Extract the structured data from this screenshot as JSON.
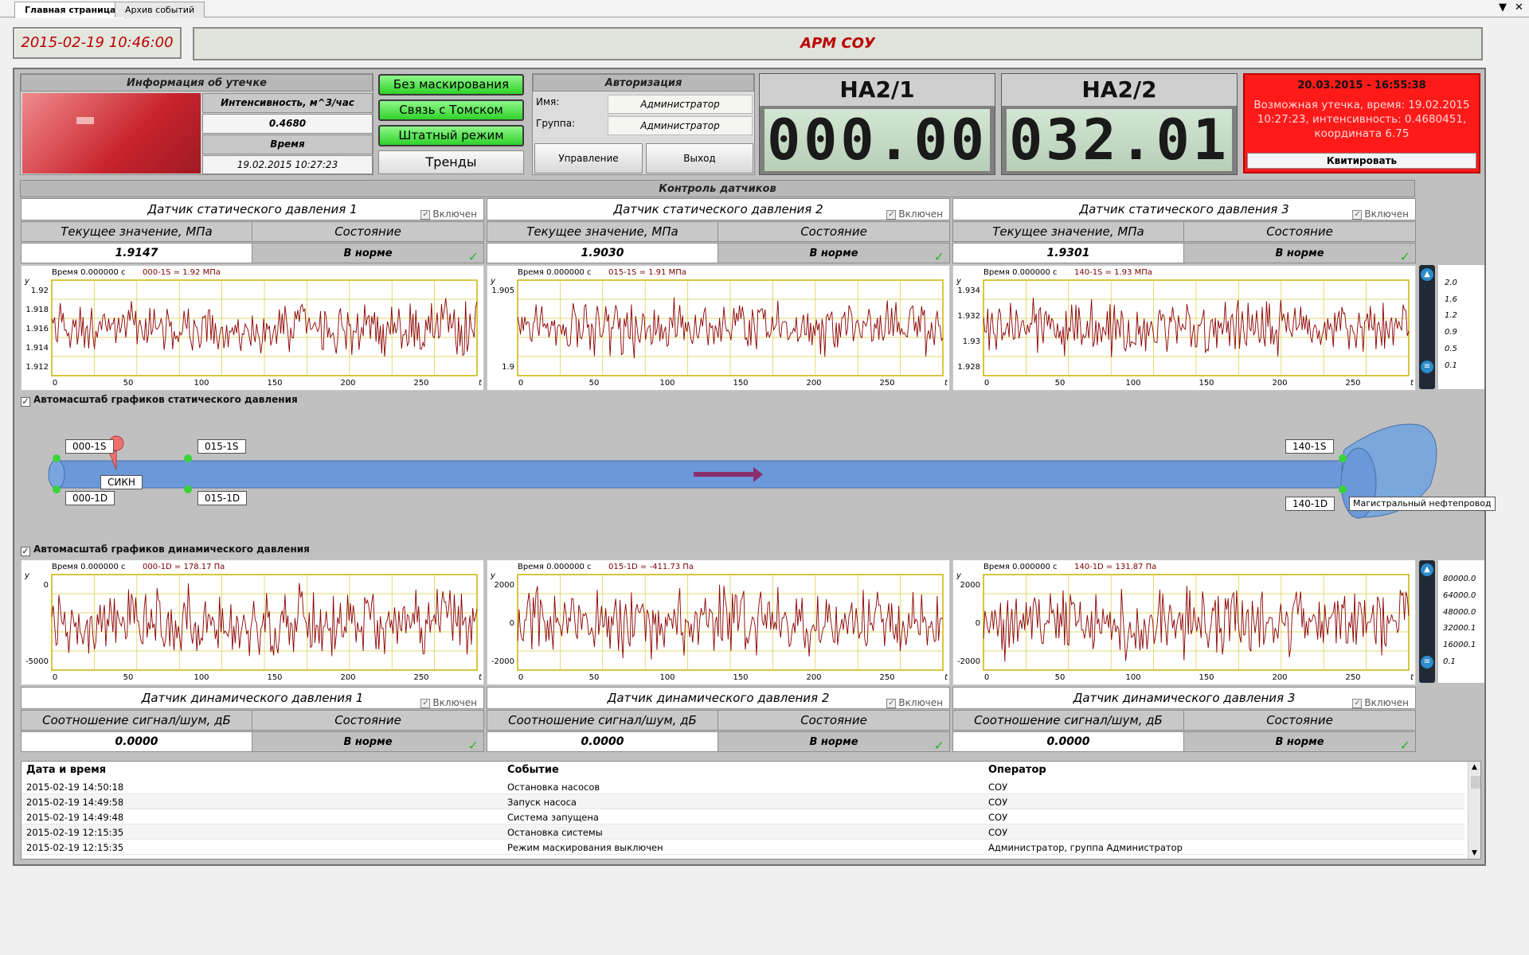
{
  "tabs": [
    {
      "label": "Главная страница",
      "active": true
    },
    {
      "label": "Архив событий",
      "active": false
    }
  ],
  "window_controls": {
    "dropdown": "▼",
    "close": "✕"
  },
  "header": {
    "datetime": "2015-02-19 10:46:00",
    "title": "АРМ СОУ"
  },
  "leak_info": {
    "title": "Информация об утечке",
    "intensity_label": "Интенсивность, м^3/час",
    "intensity_value": "0.4680",
    "time_label": "Время",
    "time_value": "19.02.2015 10:27:23"
  },
  "mode_buttons": [
    {
      "label": "Без маскирования"
    },
    {
      "label": "Связь с Томском"
    },
    {
      "label": "Штатный режим"
    }
  ],
  "trends_button": "Тренды",
  "auth": {
    "title": "Авторизация",
    "name_label": "Имя:",
    "name_value": "Администратор",
    "group_label": "Группа:",
    "group_value": "Администратор",
    "manage_label": "Управление",
    "exit_label": "Выход"
  },
  "pumps": [
    {
      "label": "НА2/1",
      "value": "000.00"
    },
    {
      "label": "НА2/2",
      "value": "032.01"
    }
  ],
  "alarm": {
    "title": "20.03.2015 - 16:55:38",
    "message": "Возможная утечка, время: 19.02.2015 10:27:23, интенсивность: 0.4680451, координата 6.75",
    "ack_label": "Квитировать",
    "color": "#ff1a1a"
  },
  "sensor_control_title": "Контроль датчиков",
  "static_sensors": [
    {
      "name": "Датчик статического давления 1",
      "enabled_label": "Включен",
      "value_header": "Текущее значение, МПа",
      "state_header": "Состояние",
      "value": "1.9147",
      "state": "В норме",
      "chart_time": "Время 0.000000 с",
      "chart_reading": "000-1S = 1.92 МПа",
      "y_ticks": [
        "1.92",
        "1.918",
        "1.916",
        "1.914",
        "1.912"
      ],
      "y_label": "y"
    },
    {
      "name": "Датчик статического давления 2",
      "enabled_label": "Включен",
      "value_header": "Текущее значение, МПа",
      "state_header": "Состояние",
      "value": "1.9030",
      "state": "В норме",
      "chart_time": "Время 0.000000 с",
      "chart_reading": "015-1S = 1.91 МПа",
      "y_ticks": [
        "1.905",
        "1.9"
      ],
      "y_label": "y"
    },
    {
      "name": "Датчик статического давления 3",
      "enabled_label": "Включен",
      "value_header": "Текущее значение, МПа",
      "state_header": "Состояние",
      "value": "1.9301",
      "state": "В норме",
      "chart_time": "Время 0.000000 с",
      "chart_reading": "140-1S = 1.93 МПа",
      "y_ticks": [
        "1.934",
        "1.932",
        "1.93",
        "1.928"
      ],
      "y_label": "y"
    }
  ],
  "static_slider_ticks": [
    "2.0",
    "1.6",
    "1.2",
    "0.9",
    "0.5",
    "0.1"
  ],
  "dynamic_slider_ticks": [
    "80000.0",
    "64000.0",
    "48000.0",
    "32000.1",
    "16000.1",
    "0.1"
  ],
  "x_ticks": [
    "0",
    "50",
    "100",
    "150",
    "200",
    "250"
  ],
  "x_label": "t",
  "autoscale_static": "Автомасштаб графиков статического давления",
  "autoscale_dynamic": "Автомасштаб графиков динамического давления",
  "pipeline": {
    "points": [
      "000-1S",
      "015-1S",
      "140-1S",
      "000-1D",
      "015-1D",
      "140-1D"
    ],
    "meter_label": "СИКН",
    "main_label": "Магистральный нефтепровод",
    "pipe_color": "#6a98d8",
    "arrow_color": "#8a2e6e"
  },
  "dynamic_sensors": [
    {
      "name": "Датчик динамического давления 1",
      "enabled_label": "Включен",
      "value_header": "Соотношение сигнал/шум, дБ",
      "state_header": "Состояние",
      "value": "0.0000",
      "state": "В норме",
      "chart_time": "Время 0.000000 с",
      "chart_reading": "000-1D = 178.17 Па",
      "y_ticks": [
        "0",
        "-5000"
      ],
      "y_label": "y"
    },
    {
      "name": "Датчик динамического давления 2",
      "enabled_label": "Включен",
      "value_header": "Соотношение сигнал/шум, дБ",
      "state_header": "Состояние",
      "value": "0.0000",
      "state": "В норме",
      "chart_time": "Время 0.000000 с",
      "chart_reading": "015-1D = -411.73 Па",
      "y_ticks": [
        "2000",
        "0",
        "-2000"
      ],
      "y_label": "y"
    },
    {
      "name": "Датчик динамического давления 3",
      "enabled_label": "Включен",
      "value_header": "Соотношение сигнал/шум, дБ",
      "state_header": "Состояние",
      "value": "0.0000",
      "state": "В норме",
      "chart_time": "Время 0.000000 с",
      "chart_reading": "140-1D = 131.87 Па",
      "y_ticks": [
        "2000",
        "0",
        "-2000"
      ],
      "y_label": "y"
    }
  ],
  "events": {
    "headers": [
      "Дата и время",
      "Событие",
      "Оператор"
    ],
    "rows": [
      [
        "2015-02-19 14:50:18",
        "Остановка насосов",
        "СОУ"
      ],
      [
        "2015-02-19 14:49:58",
        "Запуск насоса",
        "СОУ"
      ],
      [
        "2015-02-19 14:49:48",
        "Система запущена",
        "СОУ"
      ],
      [
        "2015-02-19 12:15:35",
        "Остановка системы",
        "СОУ"
      ],
      [
        "2015-02-19 12:15:35",
        "Режим маскирования выключен",
        "Администратор, группа Администратор"
      ]
    ]
  }
}
